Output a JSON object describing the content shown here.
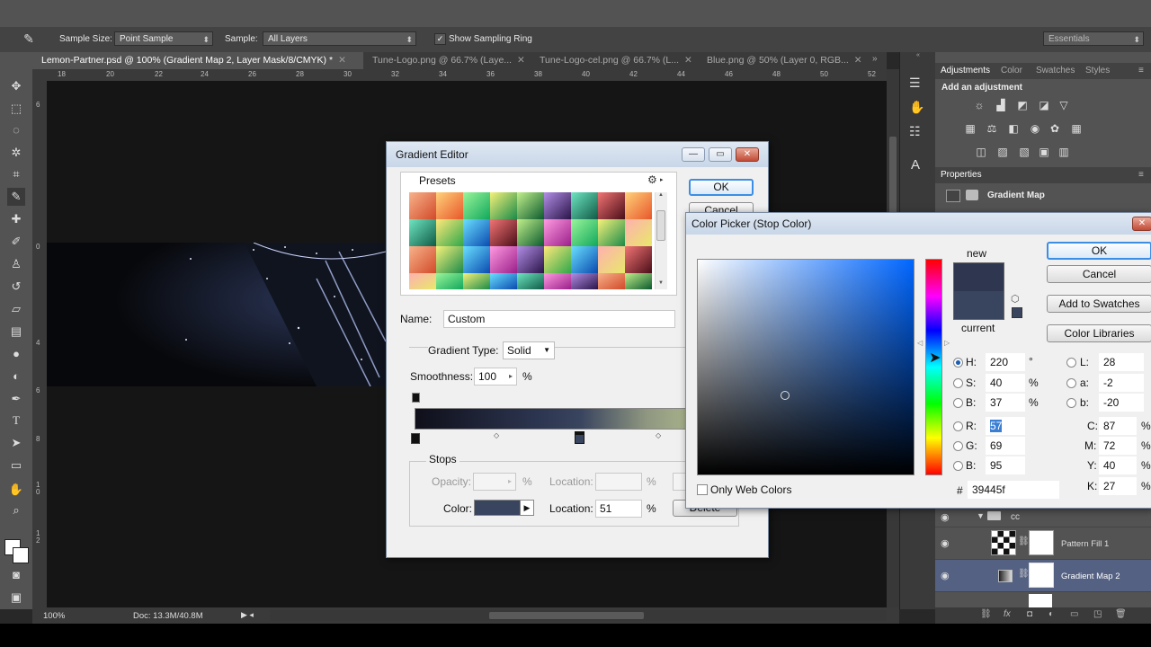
{
  "options_bar": {
    "tool_icon": "eyedropper-icon",
    "sample_size_label": "Sample Size:",
    "sample_size_value": "Point Sample",
    "sample_label": "Sample:",
    "sample_value": "All Layers",
    "show_ring_label": "Show Sampling Ring",
    "workspace": "Essentials"
  },
  "doc_tabs": [
    {
      "label": "Lemon-Partner.psd @ 100% (Gradient Map 2, Layer Mask/8/CMYK) *"
    },
    {
      "label": "Tune-Logo.png @ 66.7% (Laye..."
    },
    {
      "label": "Tune-Logo-cel.png @ 66.7% (L..."
    },
    {
      "label": "Blue.png @ 50% (Layer 0, RGB..."
    }
  ],
  "ruler_h": [
    "18",
    "20",
    "22",
    "24",
    "26",
    "28",
    "30",
    "32",
    "34",
    "36",
    "38",
    "40",
    "42",
    "44",
    "46",
    "48",
    "50",
    "52"
  ],
  "ruler_v": [
    "6",
    "0",
    "4",
    "6",
    "8",
    "1\n0",
    "1\n2"
  ],
  "status": {
    "zoom": "100%",
    "doc": "Doc: 13.3M/40.8M"
  },
  "panel": {
    "tabs": [
      "Adjustments",
      "Color",
      "Swatches",
      "Styles"
    ],
    "add_adjustment": "Add an adjustment",
    "properties_tab": "Properties",
    "properties_title": "Gradient Map"
  },
  "layers": {
    "group_name": "cc",
    "rows": [
      "Pattern Fill 1",
      "Gradient Map 2"
    ]
  },
  "gradient_editor": {
    "title": "Gradient Editor",
    "presets_label": "Presets",
    "ok": "OK",
    "cancel": "Cancel",
    "name_label": "Name:",
    "name_value": "Custom",
    "type_label": "Gradient Type:",
    "type_value": "Solid",
    "smooth_label": "Smoothness:",
    "smooth_value": "100",
    "smooth_unit": "%",
    "stops_label": "Stops",
    "opacity_label": "Opacity:",
    "opacity_unit": "%",
    "location_label": "Location:",
    "location_unit": "%",
    "color_label": "Color:",
    "color_location_label": "Location:",
    "color_location_value": "51",
    "color_location_unit": "%",
    "delete": "Delete",
    "stop_color": "#39445f"
  },
  "color_picker": {
    "title": "Color Picker (Stop Color)",
    "ok": "OK",
    "cancel": "Cancel",
    "add_swatches": "Add to Swatches",
    "libraries": "Color Libraries",
    "new_label": "new",
    "current_label": "current",
    "only_web": "Only Web Colors",
    "hash": "#",
    "hex": "39445f",
    "hsb": [
      {
        "label": "H:",
        "value": "220",
        "unit": "°"
      },
      {
        "label": "S:",
        "value": "40",
        "unit": "%"
      },
      {
        "label": "B:",
        "value": "37",
        "unit": "%"
      }
    ],
    "rgb": [
      {
        "label": "R:",
        "value": "57"
      },
      {
        "label": "G:",
        "value": "69"
      },
      {
        "label": "B:",
        "value": "95"
      }
    ],
    "lab": [
      {
        "label": "L:",
        "value": "28"
      },
      {
        "label": "a:",
        "value": "-2"
      },
      {
        "label": "b:",
        "value": "-20"
      }
    ],
    "cmyk": [
      {
        "label": "C:",
        "value": "87",
        "unit": "%"
      },
      {
        "label": "M:",
        "value": "72",
        "unit": "%"
      },
      {
        "label": "Y:",
        "value": "40",
        "unit": "%"
      },
      {
        "label": "K:",
        "value": "27",
        "unit": "%"
      }
    ],
    "new_color": "#2f3750",
    "current_color": "#39445f"
  }
}
